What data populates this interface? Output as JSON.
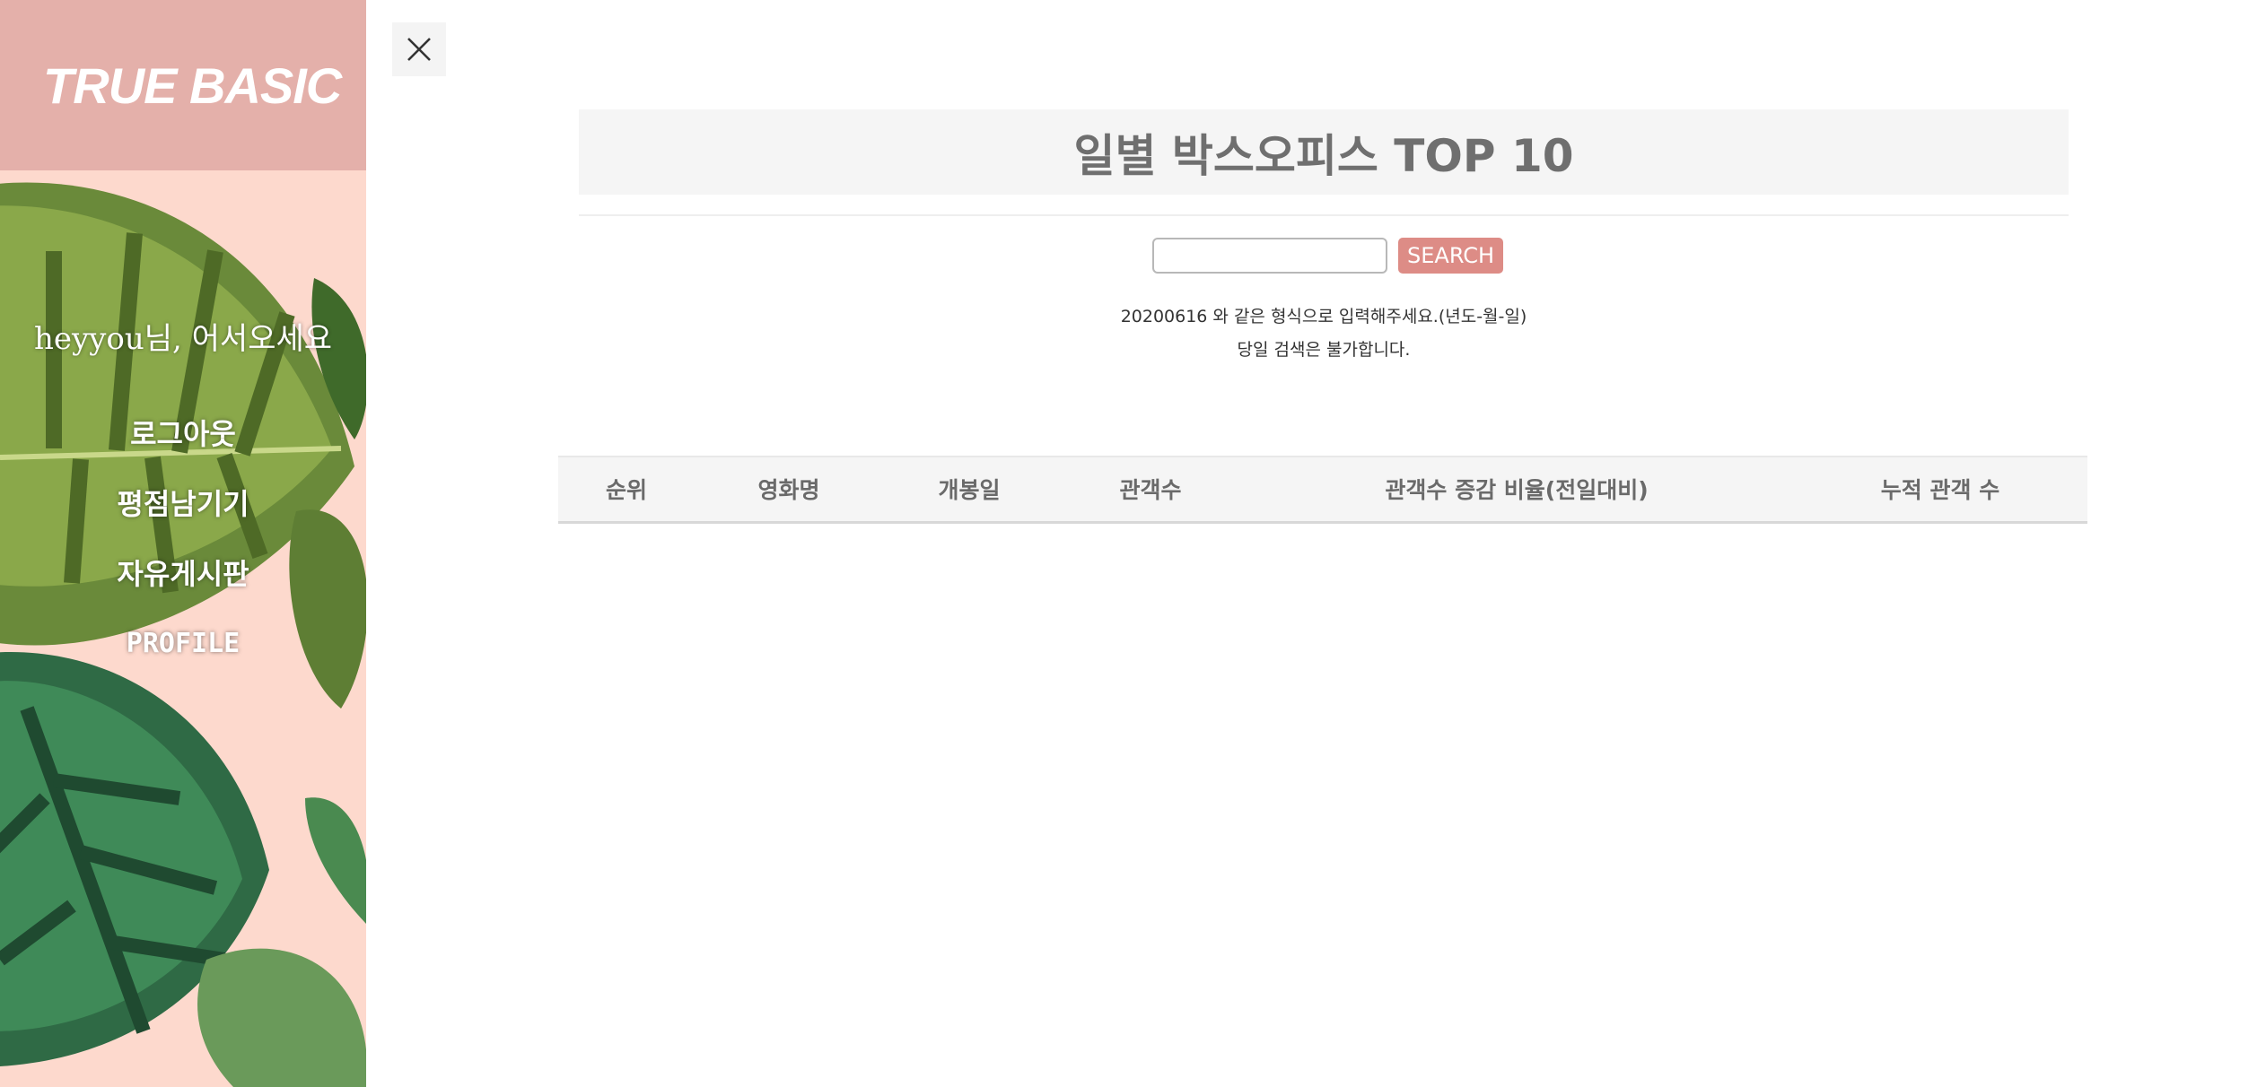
{
  "sidebar": {
    "brand": "TRUE BASIC",
    "greeting": "heyyou님, 어서오세요",
    "menu": [
      "로그아웃",
      "평점남기기",
      "자유게시판",
      "PROFILE"
    ]
  },
  "close_icon": "close-icon",
  "main": {
    "title": "일별 박스오피스 TOP 10",
    "search": {
      "value": "",
      "placeholder": "",
      "button_label": "SEARCH"
    },
    "hint_line1": "20200616 와 같은 형식으로 입력해주세요.(년도-월-일)",
    "hint_line2": "당일 검색은 불가합니다.",
    "table": {
      "columns": [
        "순위",
        "영화명",
        "개봉일",
        "관객수",
        "관객수 증감 비율(전일대비)",
        "누적 관객 수"
      ],
      "rows": []
    }
  },
  "colors": {
    "brand_bg": "#e4b0aa",
    "sidebar_bg": "#fdd9cd",
    "accent_button": "#dd8c86",
    "title_text": "#6f6f6f"
  }
}
